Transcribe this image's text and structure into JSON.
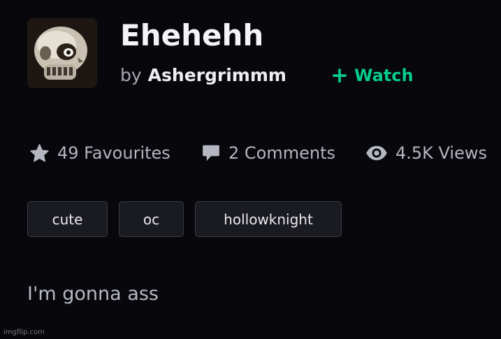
{
  "deviation": {
    "title": "Ehehehh",
    "by_label": "by",
    "author": "Ashergrimmm",
    "watch_label": "Watch",
    "description": "I'm gonna ass"
  },
  "stats": {
    "favourites": "49 Favourites",
    "comments": "2 Comments",
    "views": "4.5K Views"
  },
  "tags": [
    "cute",
    "oc",
    "hollowknight"
  ],
  "icons": {
    "avatar": "skull-avatar-image",
    "watch": "plus-icon",
    "favourites": "star-icon",
    "comments": "comment-bubble-icon",
    "views": "eye-icon"
  },
  "colors": {
    "background": "#07070c",
    "accent": "#05cc8c",
    "stat_text": "#b4b6c0",
    "tag_background": "#1a1b21",
    "tag_border": "#3b3d46"
  },
  "watermark": "imgflip.com"
}
